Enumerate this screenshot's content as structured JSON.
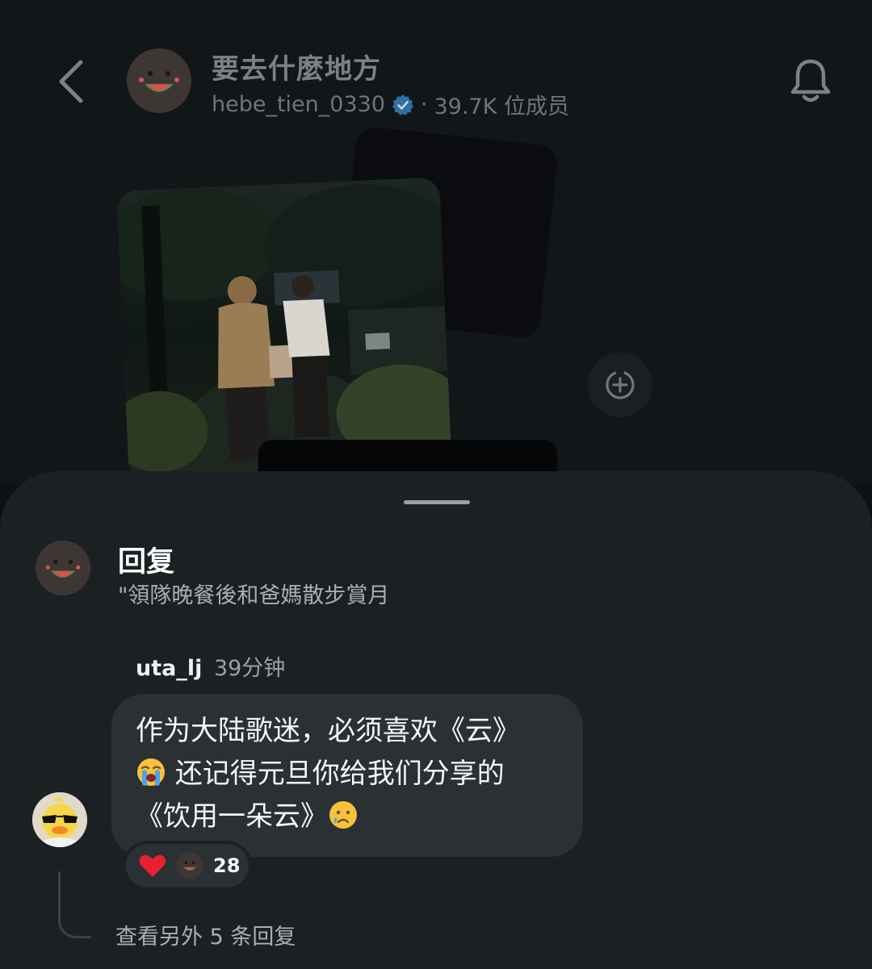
{
  "header": {
    "title": "要去什麼地方",
    "username": "hebe_tien_0330",
    "separator": "·",
    "member_count": "39.7K 位成员"
  },
  "reply_panel": {
    "title": "回复",
    "quoted_text": "\"領隊晚餐後和爸媽散步賞月"
  },
  "comment": {
    "username": "uta_lj",
    "time": "39分钟",
    "line1": "作为大陆歌迷，必须喜欢《云》",
    "line2": "还记得元旦你给我们分享的",
    "line3": "《饮用一朵云》",
    "reaction_count": "28"
  },
  "more_replies": "查看另外 5 条回复",
  "colors": {
    "background": "#121619",
    "sheet": "#1b2023",
    "bubble": "#2a3034",
    "verified": "#2f8fdc",
    "heart": "#e8202f"
  }
}
